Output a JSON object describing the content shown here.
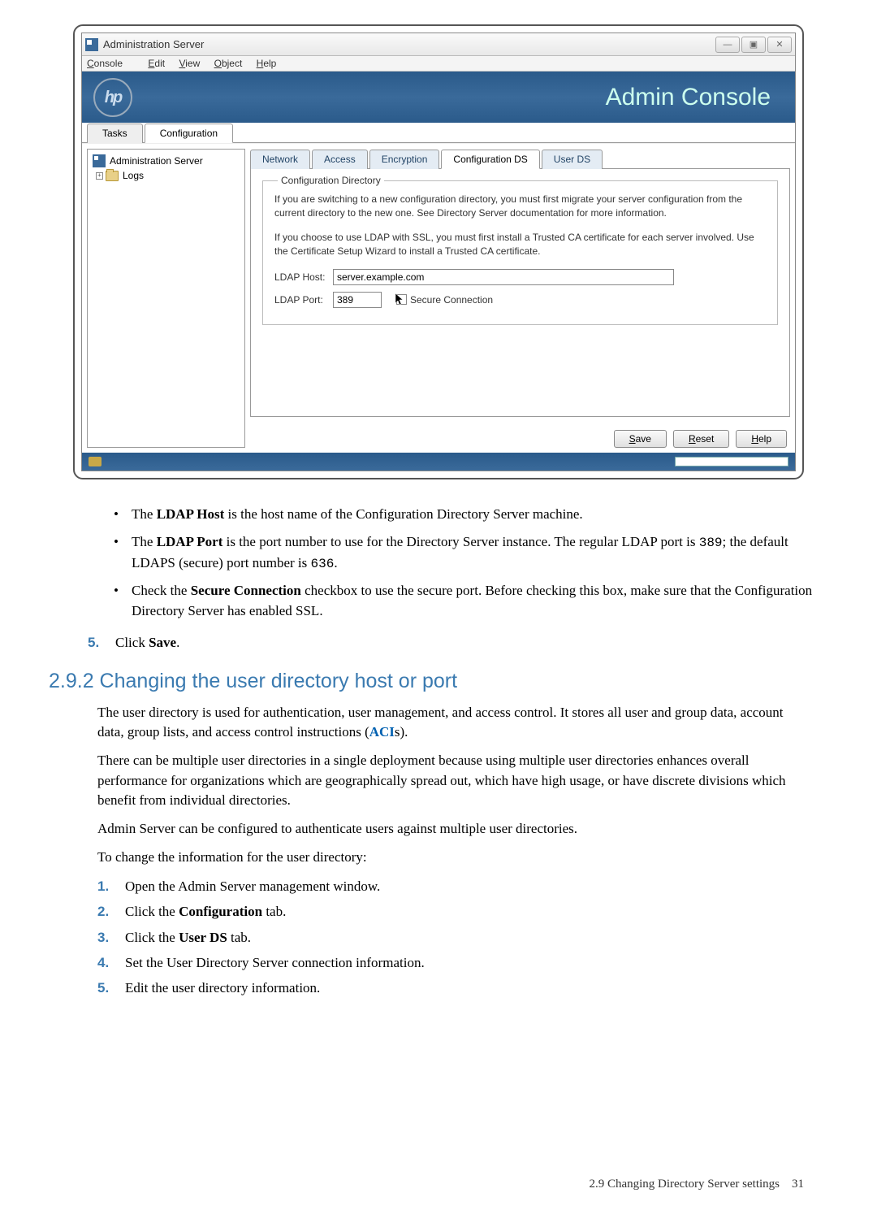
{
  "window": {
    "title": "Administration Server",
    "min": "—",
    "max": "▣",
    "close": "✕"
  },
  "menubar": {
    "console": "Console",
    "edit": "Edit",
    "view": "View",
    "object": "Object",
    "help": "Help"
  },
  "banner": {
    "logo": "hp",
    "title": "Admin Console"
  },
  "maintabs": {
    "tasks": "Tasks",
    "configuration": "Configuration"
  },
  "tree": {
    "root": "Administration Server",
    "expand": "+",
    "logs": "Logs"
  },
  "subtabs": {
    "network": "Network",
    "access": "Access",
    "encryption": "Encryption",
    "configds": "Configuration DS",
    "userds": "User DS"
  },
  "fieldset": {
    "legend": "Configuration Directory",
    "para1": "If you are switching to a new configuration directory, you must first migrate your server configuration from the current directory to the new one. See Directory Server documentation for more information.",
    "para2": "If you choose to use LDAP with SSL, you must first install a Trusted CA certificate for each server involved. Use the Certificate Setup Wizard to install a Trusted CA certificate.",
    "ldap_host_label": "LDAP Host:",
    "ldap_host_value": "server.example.com",
    "ldap_port_label": "LDAP Port:",
    "ldap_port_value": "389",
    "secure_connection": "Secure Connection"
  },
  "buttons": {
    "save": "Save",
    "reset": "Reset",
    "help": "Help"
  },
  "doc": {
    "bullet1a": "The ",
    "bullet1b": "LDAP Host",
    "bullet1c": " is the host name of the Configuration Directory Server machine.",
    "bullet2a": "The ",
    "bullet2b": "LDAP Port",
    "bullet2c": " is the port number to use for the Directory Server instance. The regular LDAP port is ",
    "bullet2d": "389",
    "bullet2e": "; the default LDAPS (secure) port number is ",
    "bullet2f": "636",
    "bullet2g": ".",
    "bullet3a": "Check the ",
    "bullet3b": "Secure Connection",
    "bullet3c": " checkbox to use the secure port. Before checking this box, make sure that the Configuration Directory Server has enabled SSL.",
    "step5num": "5.",
    "step5a": "Click ",
    "step5b": "Save",
    "step5c": "."
  },
  "section": {
    "heading": "2.9.2 Changing the user directory host or port",
    "p1a": "The user directory is used for authentication, user management, and access control. It stores all user and group data, account data, group lists, and access control instructions (",
    "p1b": "ACI",
    "p1c": "s).",
    "p2": "There can be multiple user directories in a single deployment because using multiple user directories enhances overall performance for organizations which are geographically spread out, which have high usage, or have discrete divisions which benefit from individual directories.",
    "p3": "Admin Server can be configured to authenticate users against multiple user directories.",
    "p4": "To change the information for the user directory:",
    "s1n": "1.",
    "s1": "Open the Admin Server management window.",
    "s2n": "2.",
    "s2a": "Click the ",
    "s2b": "Configuration",
    "s2c": " tab.",
    "s3n": "3.",
    "s3a": "Click the ",
    "s3b": "User DS",
    "s3c": " tab.",
    "s4n": "4.",
    "s4": "Set the User Directory Server connection information.",
    "s5n": "5.",
    "s5": "Edit the user directory information."
  },
  "footer": {
    "text": "2.9 Changing Directory Server settings",
    "page": "31"
  }
}
